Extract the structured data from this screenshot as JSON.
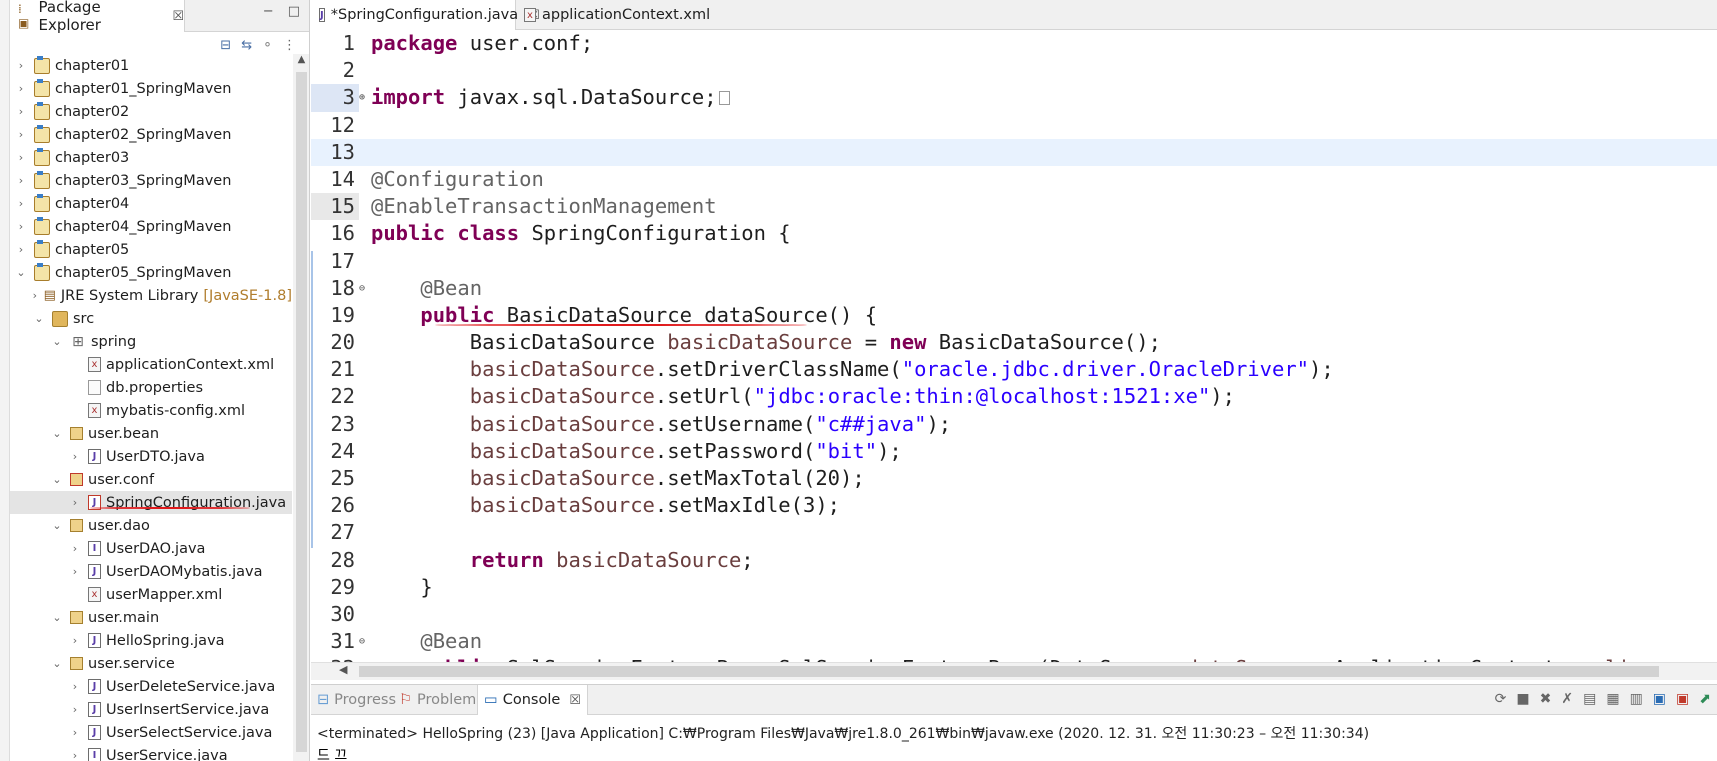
{
  "explorer": {
    "tab_title": "Package Explorer",
    "tab_close": "☒",
    "minimize": "−",
    "maximize": "□",
    "tree": [
      {
        "label": "chapter01",
        "icon": "project-icon"
      },
      {
        "label": "chapter01_SpringMaven",
        "icon": "maven-project-icon"
      },
      {
        "label": "chapter02",
        "icon": "project-icon"
      },
      {
        "label": "chapter02_SpringMaven",
        "icon": "maven-project-icon"
      },
      {
        "label": "chapter03",
        "icon": "project-icon"
      },
      {
        "label": "chapter03_SpringMaven",
        "icon": "maven-project-icon"
      },
      {
        "label": "chapter04",
        "icon": "project-icon"
      },
      {
        "label": "chapter04_SpringMaven",
        "icon": "maven-project-icon"
      },
      {
        "label": "chapter05",
        "icon": "project-icon"
      },
      {
        "label": "chapter05_SpringMaven",
        "icon": "maven-project-icon"
      },
      {
        "label": "JRE System Library",
        "decoration": "[JavaSE-1.8]",
        "icon": "library-icon"
      },
      {
        "label": "src",
        "icon": "source-folder-icon"
      },
      {
        "label": "spring",
        "icon": "package-folder-icon"
      },
      {
        "label": "applicationContext.xml",
        "icon": "xml-file-icon"
      },
      {
        "label": "db.properties",
        "icon": "properties-file-icon"
      },
      {
        "label": "mybatis-config.xml",
        "icon": "xml-file-icon"
      },
      {
        "label": "user.bean",
        "icon": "package-icon"
      },
      {
        "label": "UserDTO.java",
        "icon": "java-file-icon"
      },
      {
        "label": "user.conf",
        "icon": "package-icon"
      },
      {
        "label": "SpringConfiguration.java",
        "icon": "java-file-icon"
      },
      {
        "label": "user.dao",
        "icon": "package-icon"
      },
      {
        "label": "UserDAO.java",
        "icon": "java-interface-icon"
      },
      {
        "label": "UserDAOMybatis.java",
        "icon": "java-file-icon"
      },
      {
        "label": "userMapper.xml",
        "icon": "xml-file-icon"
      },
      {
        "label": "user.main",
        "icon": "package-icon"
      },
      {
        "label": "HelloSpring.java",
        "icon": "java-file-icon"
      },
      {
        "label": "user.service",
        "icon": "package-icon"
      },
      {
        "label": "UserDeleteService.java",
        "icon": "java-file-icon"
      },
      {
        "label": "UserInsertService.java",
        "icon": "java-file-icon"
      },
      {
        "label": "UserSelectService.java",
        "icon": "java-file-icon"
      },
      {
        "label": "UserService.java",
        "icon": "java-interface-icon"
      }
    ]
  },
  "editor": {
    "tabs": [
      {
        "label": "*SpringConfiguration.java",
        "close": "☒"
      },
      {
        "label": "applicationContext.xml"
      }
    ],
    "lines": [
      {
        "n": "1",
        "t": "package user.conf;"
      },
      {
        "n": "2",
        "t": ""
      },
      {
        "n": "3",
        "t": "import javax.sql.DataSource;"
      },
      {
        "n": "12",
        "t": ""
      },
      {
        "n": "13",
        "t": ""
      },
      {
        "n": "14",
        "t": "@Configuration"
      },
      {
        "n": "15",
        "t": "@EnableTransactionManagement"
      },
      {
        "n": "16",
        "t": "public class SpringConfiguration {"
      },
      {
        "n": "17",
        "t": ""
      },
      {
        "n": "18",
        "t": "    @Bean"
      },
      {
        "n": "19",
        "t": "    public BasicDataSource dataSource() {"
      },
      {
        "n": "20",
        "t": "        BasicDataSource basicDataSource = new BasicDataSource();"
      },
      {
        "n": "21",
        "t": "        basicDataSource.setDriverClassName(\"oracle.jdbc.driver.OracleDriver\");"
      },
      {
        "n": "22",
        "t": "        basicDataSource.setUrl(\"jdbc:oracle:thin:@localhost:1521:xe\");"
      },
      {
        "n": "23",
        "t": "        basicDataSource.setUsername(\"c##java\");"
      },
      {
        "n": "24",
        "t": "        basicDataSource.setPassword(\"bit\");"
      },
      {
        "n": "25",
        "t": "        basicDataSource.setMaxTotal(20);"
      },
      {
        "n": "26",
        "t": "        basicDataSource.setMaxIdle(3);"
      },
      {
        "n": "27",
        "t": ""
      },
      {
        "n": "28",
        "t": "        return basicDataSource;"
      },
      {
        "n": "29",
        "t": "    }"
      },
      {
        "n": "30",
        "t": ""
      },
      {
        "n": "31",
        "t": "    @Bean"
      },
      {
        "n": "32",
        "t": "    public SqlSessionFactoryBean SqlSessionFactoryBean(DataSource dataSource, ApplicationContext applica"
      }
    ]
  },
  "console": {
    "tabs": [
      {
        "label": "Progress",
        "icon": "progress-icon"
      },
      {
        "label": "Problems",
        "icon": "problems-icon"
      },
      {
        "label": "Console",
        "icon": "console-icon",
        "close": "☒"
      }
    ],
    "status": "<terminated> HelloSpring (23) [Java Application] C:₩Program Files₩Java₩jre1.8.0_261₩bin₩javaw.exe  (2020. 12. 31. 오전 11:30:23 – 오전 11:30:34)",
    "output": "드 끄"
  }
}
